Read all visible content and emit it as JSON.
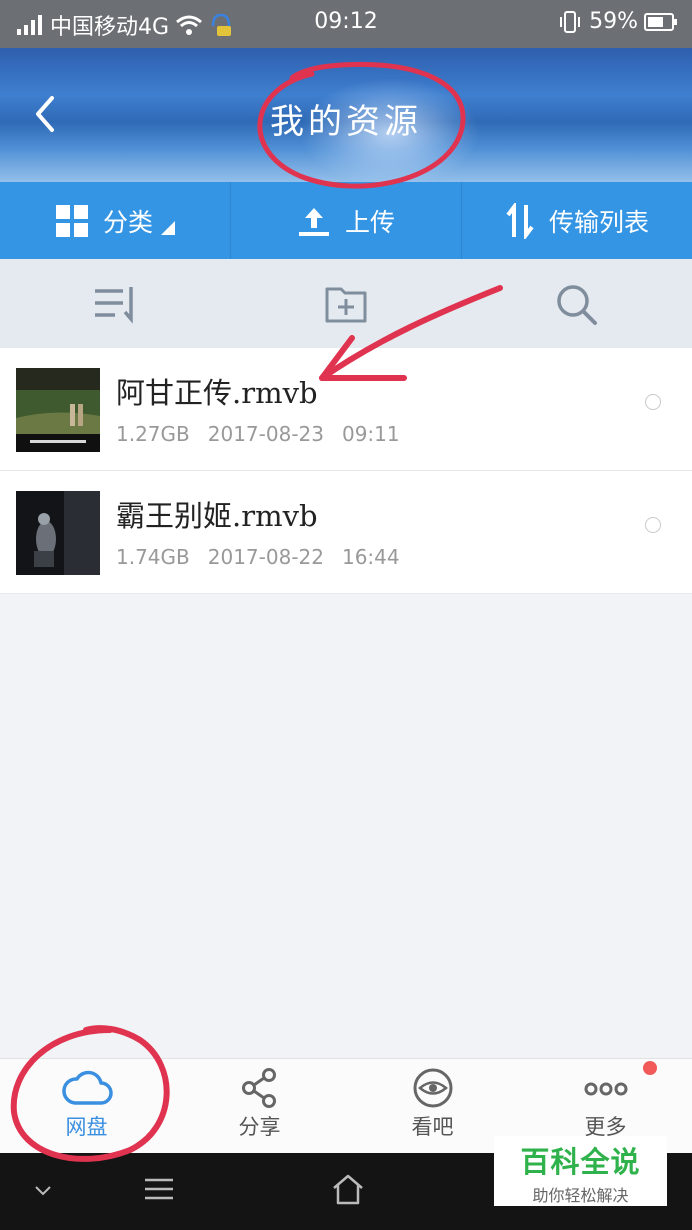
{
  "status_bar": {
    "carrier": "中国移动4G",
    "time": "09:12",
    "battery": "59%"
  },
  "header": {
    "title": "我的资源"
  },
  "toolbar": {
    "category": "分类",
    "upload": "上传",
    "transfer": "传输列表"
  },
  "files": [
    {
      "name": "阿甘正传.rmvb",
      "size": "1.27GB",
      "date": "2017-08-23",
      "time": "09:11"
    },
    {
      "name": "霸王别姬.rmvb",
      "size": "1.74GB",
      "date": "2017-08-22",
      "time": "16:44"
    }
  ],
  "tabs": [
    {
      "label": "网盘",
      "icon": "cloud-icon"
    },
    {
      "label": "分享",
      "icon": "share-icon"
    },
    {
      "label": "看吧",
      "icon": "eye-icon"
    },
    {
      "label": "更多",
      "icon": "more-icon"
    }
  ],
  "watermark": {
    "title": "百科全说",
    "subtitle": "助你轻松解决"
  },
  "colors": {
    "accent": "#3495e4",
    "annotation": "#e0334f",
    "watermark": "#2fb24b"
  }
}
